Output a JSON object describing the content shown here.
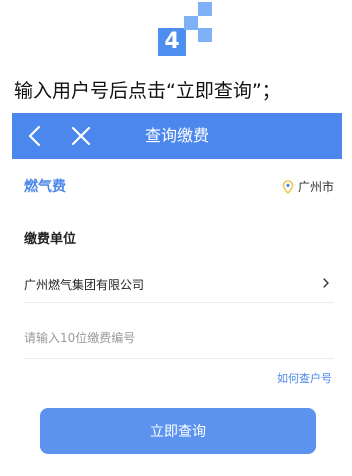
{
  "step": {
    "number": "4"
  },
  "instruction": "输入用户号后点击“立即查询”；",
  "header": {
    "title": "查询缴费"
  },
  "service": {
    "name": "燃气费",
    "location": "广州市"
  },
  "section": {
    "title": "缴费单位"
  },
  "company": {
    "name": "广州燃气集团有限公司"
  },
  "account": {
    "value": "",
    "placeholder": "请输入10位缴费编号"
  },
  "help_link": "如何查户号",
  "submit_label": "立即查询",
  "colors": {
    "accent": "#4b87ec",
    "button": "#5b93ef",
    "pin": "#f2c34d"
  }
}
